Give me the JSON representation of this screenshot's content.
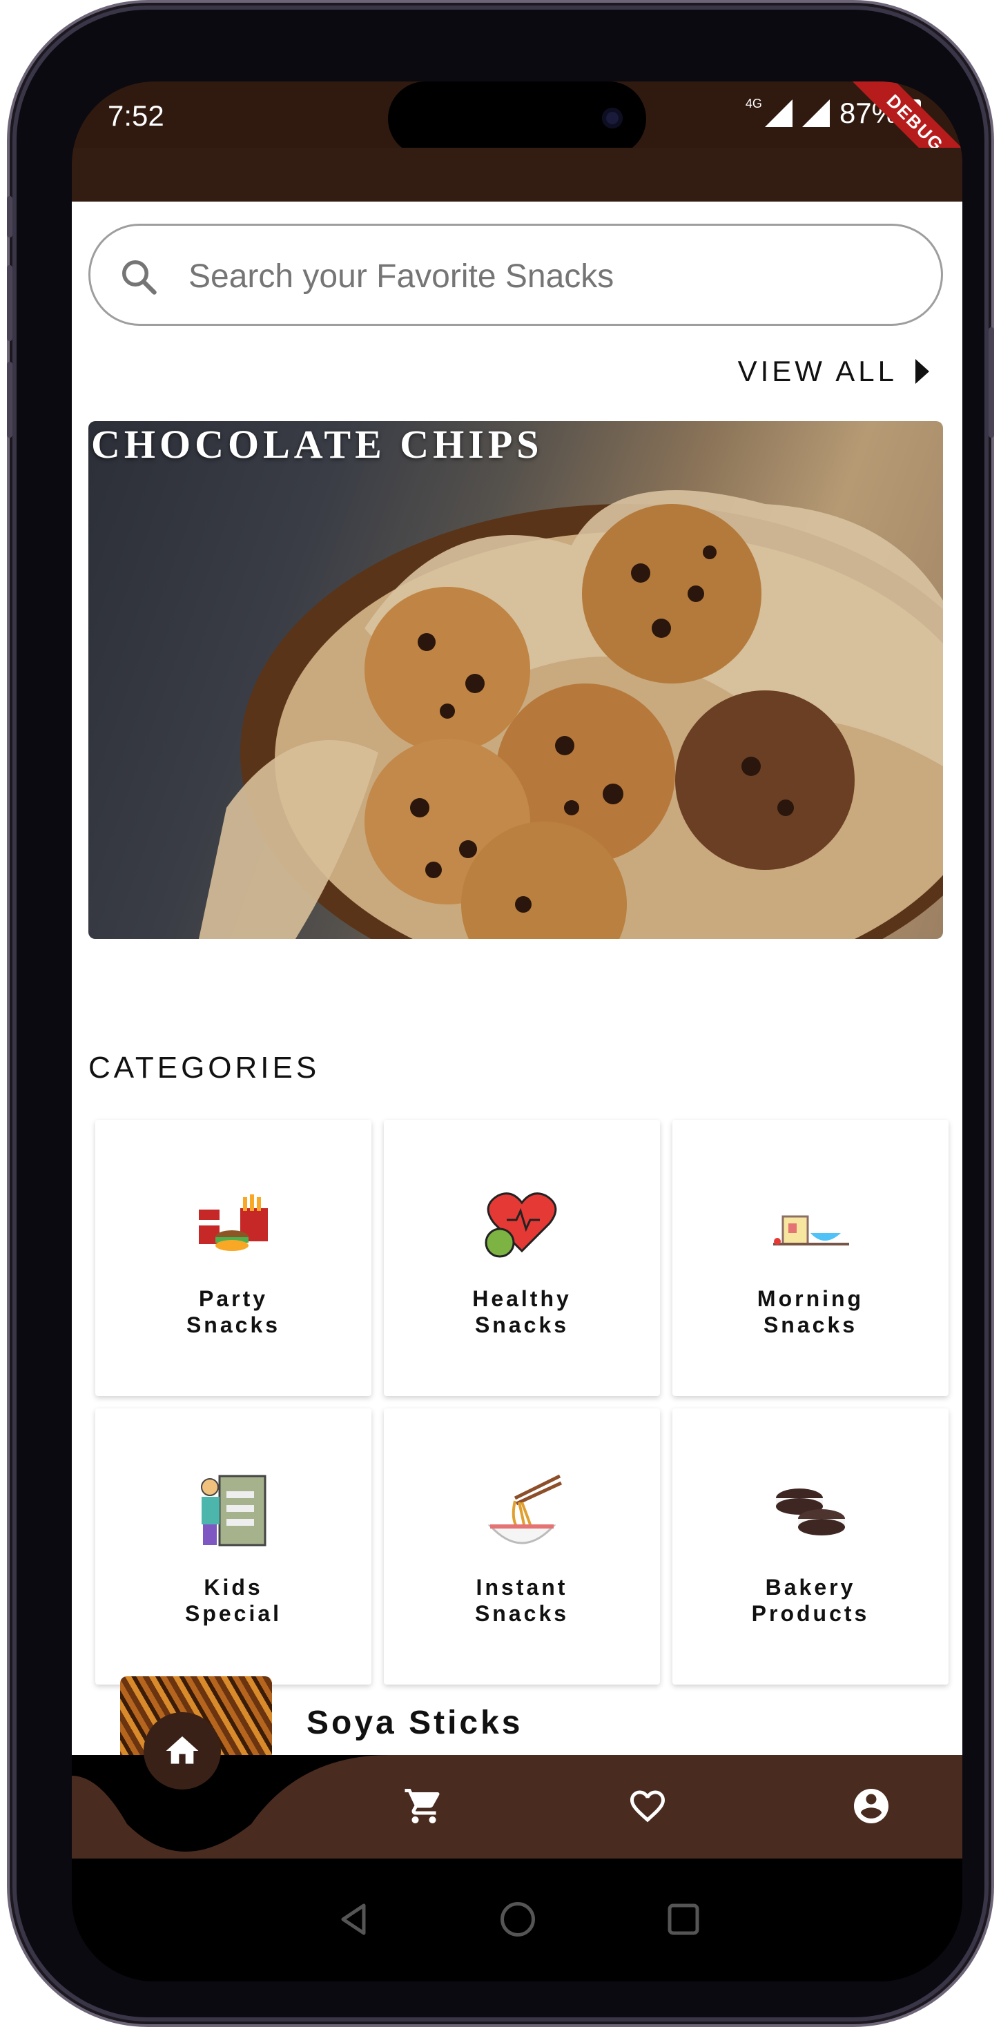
{
  "status": {
    "time": "7:52",
    "network": "4G",
    "battery": "87%",
    "debug_banner": "DEBUG"
  },
  "search": {
    "placeholder": "Search your Favorite Snacks",
    "icon": "search-icon"
  },
  "view_all": {
    "label": "VIEW ALL",
    "icon": "arrow-right-icon"
  },
  "banner": {
    "title": "CHOCOLATE CHIPS"
  },
  "categories": {
    "title": "CATEGORIES",
    "items": [
      {
        "label": "Party\nSnacks",
        "icon": "party-snacks-icon"
      },
      {
        "label": "Healthy\nSnacks",
        "icon": "healthy-snacks-icon"
      },
      {
        "label": "Morning\nSnacks",
        "icon": "morning-snacks-icon"
      },
      {
        "label": "Kids\nSpecial",
        "icon": "kids-special-icon"
      },
      {
        "label": "Instant\nSnacks",
        "icon": "instant-snacks-icon"
      },
      {
        "label": "Bakery\nProducts",
        "icon": "bakery-products-icon"
      }
    ]
  },
  "product": {
    "name": "Soya Sticks"
  },
  "bottom_nav": {
    "items": [
      "home-icon",
      "cart-icon",
      "heart-icon",
      "account-icon"
    ],
    "active": "home"
  },
  "system_nav": [
    "back-icon",
    "home-circle-icon",
    "recents-icon"
  ],
  "colors": {
    "brand_dark_brown": "#331c12",
    "nav_brown": "#4a2b20",
    "debug_red": "#b71c1c"
  }
}
